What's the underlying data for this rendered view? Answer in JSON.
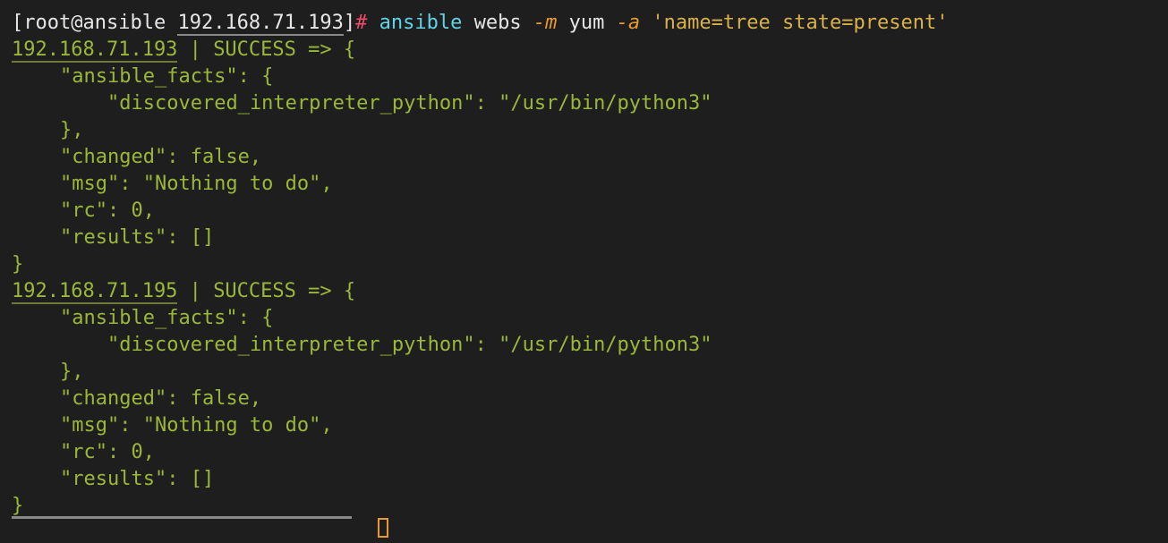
{
  "prompt": {
    "open_bracket": "[",
    "user_host": "root@ansible",
    "host_ip": "192.168.71.193",
    "close_bracket": "]",
    "symbol": "#"
  },
  "command": {
    "bin": "ansible",
    "target": "webs",
    "flag_module": "-m",
    "module": "yum",
    "flag_args": "-a",
    "args": "'name=tree state=present'"
  },
  "results": [
    {
      "host": "192.168.71.193",
      "status": "SUCCESS",
      "arrow": "=> {",
      "facts_key": "\"ansible_facts\": {",
      "interp_key": "\"discovered_interpreter_python\"",
      "interp_val": "\"/usr/bin/python3\"",
      "facts_close": "},",
      "changed": "\"changed\": false,",
      "msg": "\"msg\": \"Nothing to do\",",
      "rc": "\"rc\": 0,",
      "results_line": "\"results\": []",
      "close": "}"
    },
    {
      "host": "192.168.71.195",
      "status": "SUCCESS",
      "arrow": "=> {",
      "facts_key": "\"ansible_facts\": {",
      "interp_key": "\"discovered_interpreter_python\"",
      "interp_val": "\"/usr/bin/python3\"",
      "facts_close": "},",
      "changed": "\"changed\": false,",
      "msg": "\"msg\": \"Nothing to do\",",
      "rc": "\"rc\": 0,",
      "results_line": "\"results\": []",
      "close": "}"
    }
  ],
  "colors": {
    "background": "#1e1e1e",
    "output": "#9bb73a",
    "command": "#5fd4e8",
    "prompt_symbol": "#f14b6b",
    "flags": "#e89b2c",
    "cursor": "#e89b2c"
  }
}
